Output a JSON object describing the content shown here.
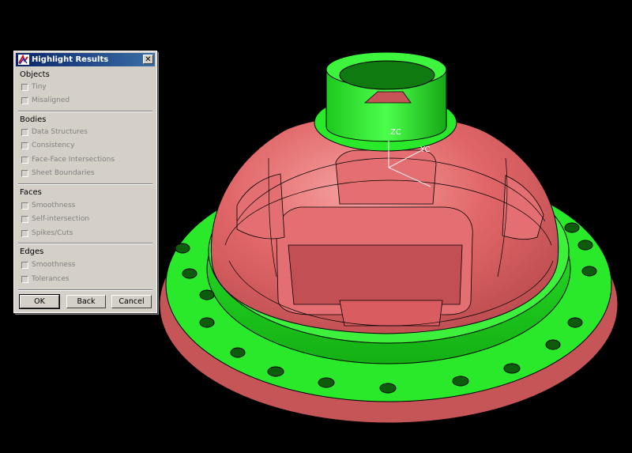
{
  "dialog": {
    "title": "Highlight Results",
    "close_glyph": "✕",
    "sections": [
      {
        "name": "Objects",
        "items": [
          "Tiny",
          "Misaligned"
        ]
      },
      {
        "name": "Bodies",
        "items": [
          "Data Structures",
          "Consistency",
          "Face-Face Intersections",
          "Sheet Boundaries"
        ]
      },
      {
        "name": "Faces",
        "items": [
          "Smoothness",
          "Self-intersection",
          "Spikes/Cuts"
        ]
      },
      {
        "name": "Edges",
        "items": [
          "Smoothness",
          "Tolerances"
        ]
      }
    ],
    "buttons": {
      "ok": "OK",
      "back": "Back",
      "cancel": "Cancel"
    }
  },
  "viewport": {
    "axis_labels": {
      "zc": "ZC",
      "yc": "YC"
    },
    "colors": {
      "background": "#000000",
      "body": "#e8686c",
      "flange": "#22e622",
      "edge_lines": "#000000"
    }
  }
}
